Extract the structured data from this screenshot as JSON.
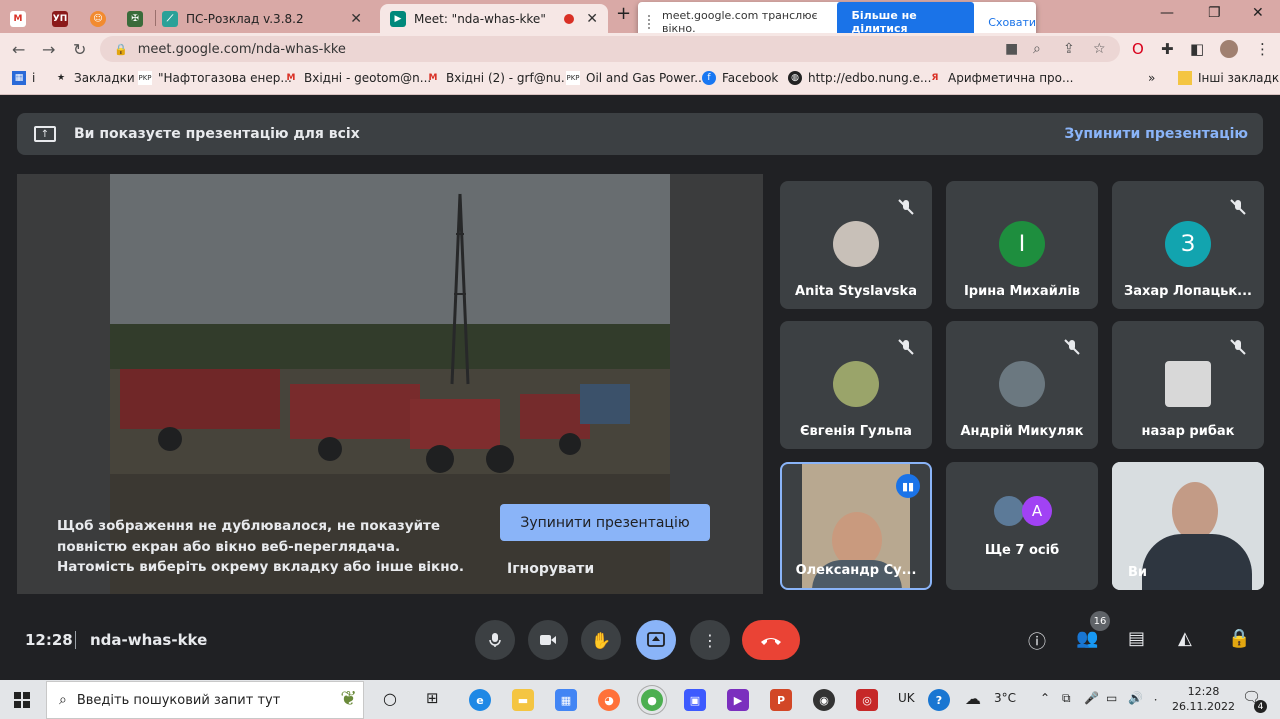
{
  "browser": {
    "tabs": [
      {
        "favicon": "gmail-icon",
        "label": ""
      },
      {
        "favicon": "up-icon",
        "label": ""
      },
      {
        "favicon": "orange-icon",
        "label": ""
      },
      {
        "favicon": "crest-icon",
        "label": ""
      },
      {
        "favicon": "schedule-icon",
        "label": "ПС-Розклад v.3.8.2"
      },
      {
        "favicon": "meet-icon",
        "label": "Meet: \"nda-whas-kke\""
      }
    ],
    "url": "meet.google.com/nda-whas-kke",
    "share_popup": {
      "text": "meet.google.com транслює вікно.",
      "stop_label": "Більше не ділитися",
      "hide_label": "Сховати"
    },
    "bookmarks": [
      {
        "icon": "apps-icon",
        "label": "і"
      },
      {
        "icon": "star-icon",
        "label": "Закладки"
      },
      {
        "icon": "pkp-icon",
        "label": "\"Нафтогазова енер..."
      },
      {
        "icon": "gmail-icon",
        "label": "Вхідні - geotom@n..."
      },
      {
        "icon": "gmail-icon",
        "label": "Вхідні (2) - grf@nu..."
      },
      {
        "icon": "pkp-icon",
        "label": "Oil and Gas Power..."
      },
      {
        "icon": "facebook-icon",
        "label": "Facebook"
      },
      {
        "icon": "globe-icon",
        "label": "http://edbo.nung.e..."
      },
      {
        "icon": "arith-icon",
        "label": "Арифметична про..."
      }
    ],
    "other_bookmarks": "Інші закладки"
  },
  "meet": {
    "banner_text": "Ви показуєте презентацію для всіх",
    "banner_stop": "Зупинити презентацію",
    "presentation": {
      "message": "Щоб зображення не дублювалося, не показуйте повністю екран або вікно веб-переглядача. Натомість виберіть окрему вкладку або інше вікно.",
      "stop_button": "Зупинити презентацію",
      "ignore_button": "Ігнорувати"
    },
    "participants": [
      {
        "name": "Anita Styslavska",
        "avatar": "photo",
        "muted": true
      },
      {
        "name": "Ірина Михайлів",
        "avatar": "І",
        "color": "#1e8e3e",
        "muted": false
      },
      {
        "name": "Захар Лопацьк...",
        "avatar": "З",
        "color": "#12a4af",
        "muted": true
      },
      {
        "name": "Євгенія Гульпа",
        "avatar": "photo",
        "muted": true
      },
      {
        "name": "Андрій Микуляк",
        "avatar": "photo",
        "muted": true
      },
      {
        "name": "назар рибак",
        "avatar": "photo",
        "muted": true
      },
      {
        "name": "Олександр Су...",
        "avatar": "video",
        "muted": false
      },
      {
        "name": "Ще 7 осіб",
        "avatar": "A",
        "color": "#a142f4",
        "muted": false
      },
      {
        "name": "Ви",
        "avatar": "video",
        "muted": false
      }
    ],
    "time": "12:28",
    "meeting_code": "nda-whas-kke",
    "participant_count": "16"
  },
  "taskbar": {
    "search_placeholder": "Введіть пошуковий запит тут",
    "language": "UK",
    "weather": "3°C",
    "time": "12:28",
    "date": "26.11.2022",
    "notifications": "4"
  }
}
